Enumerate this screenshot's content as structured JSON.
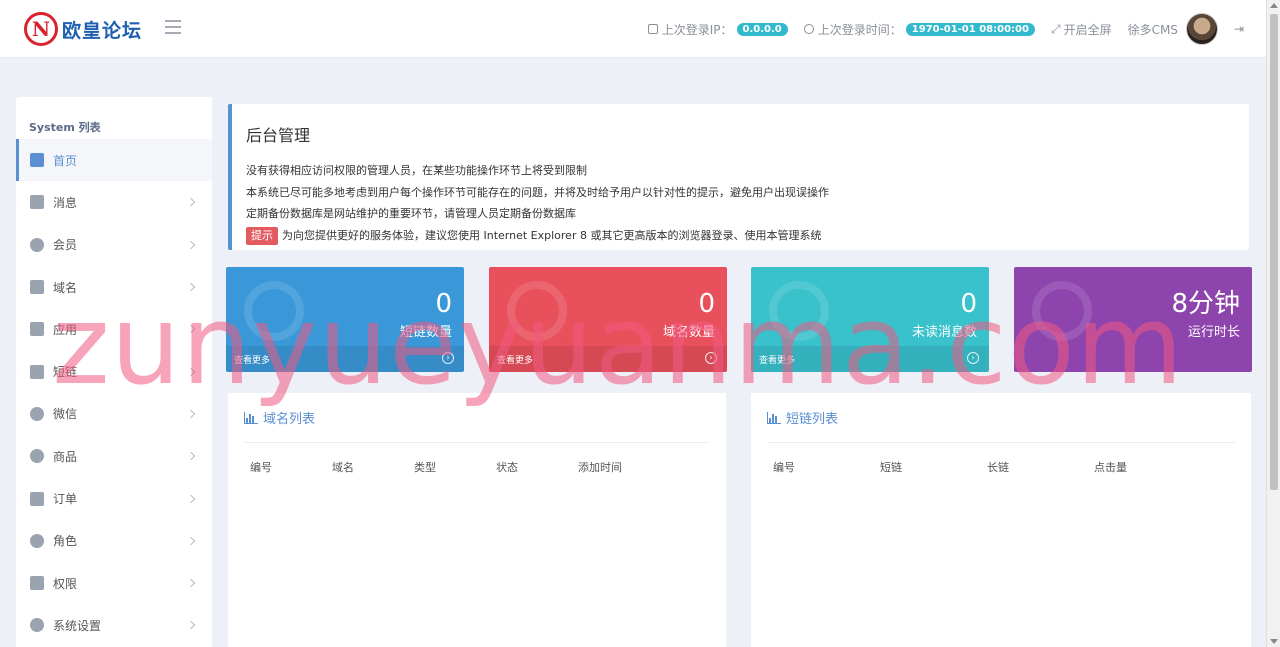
{
  "header": {
    "logo_mark": "N",
    "logo_text": "欧皇论坛",
    "last_ip_label": "上次登录IP：",
    "last_ip_value": "0.0.0.0",
    "last_time_label": "上次登录时间：",
    "last_time_value": "1970-01-01 08:00:00",
    "fullscreen_label": "开启全屏",
    "user_name": "徐多CMS"
  },
  "sidebar": {
    "title": "System 列表",
    "items": [
      {
        "label": "首页",
        "icon": "home-icon"
      },
      {
        "label": "消息",
        "icon": "file-icon"
      },
      {
        "label": "会员",
        "icon": "user-icon"
      },
      {
        "label": "域名",
        "icon": "link-icon"
      },
      {
        "label": "应用",
        "icon": "gift-icon"
      },
      {
        "label": "短链",
        "icon": "link-icon"
      },
      {
        "label": "微信",
        "icon": "wechat-icon"
      },
      {
        "label": "商品",
        "icon": "product-icon"
      },
      {
        "label": "订单",
        "icon": "order-icon"
      },
      {
        "label": "角色",
        "icon": "user-icon"
      },
      {
        "label": "权限",
        "icon": "key-icon"
      },
      {
        "label": "系统设置",
        "icon": "gears-icon"
      }
    ]
  },
  "notice": {
    "title": "后台管理",
    "line1": "没有获得相应访问权限的管理人员，在某些功能操作环节上将受到限制",
    "line2": "本系统已尽可能多地考虑到用户每个操作环节可能存在的问题，并将及时给予用户以针对性的提示，避免用户出现误操作",
    "line3": "定期备份数据库是网站维护的重要环节，请管理人员定期备份数据库",
    "tip_badge": "提示",
    "tip_text": "为向您提供更好的服务体验，建议您使用 Internet Explorer 8 或其它更高版本的浏览器登录、使用本管理系统"
  },
  "stats": [
    {
      "value": "0",
      "label": "短链数量",
      "more": "查看更多",
      "color": "#3a98d8"
    },
    {
      "value": "0",
      "label": "域名数量",
      "more": "查看更多",
      "color": "#e8505c"
    },
    {
      "value": "0",
      "label": "未读消息数",
      "more": "查看更多",
      "color": "#39c1cc"
    },
    {
      "value": "8分钟",
      "label": "运行时长",
      "more": "",
      "color": "#8e44ad"
    }
  ],
  "domain_panel": {
    "title": "域名列表",
    "columns": [
      "编号",
      "域名",
      "类型",
      "状态",
      "添加时间"
    ]
  },
  "shortlink_panel": {
    "title": "短链列表",
    "columns": [
      "编号",
      "短链",
      "长链",
      "点击量"
    ]
  },
  "watermark": "zunyueyuanma.com"
}
